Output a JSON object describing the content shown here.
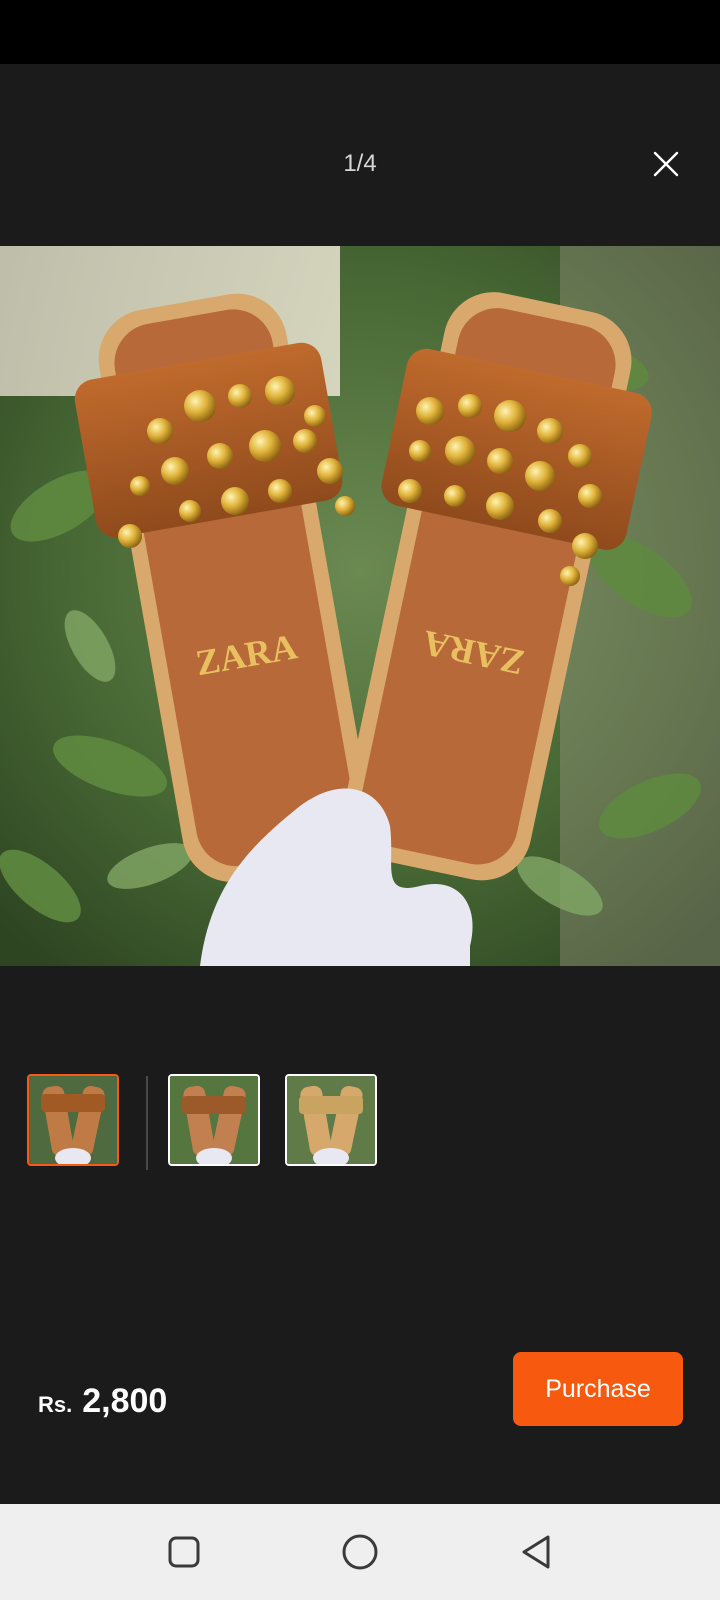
{
  "viewer": {
    "page_counter": "1/4",
    "close_icon": "close-icon"
  },
  "product_image": {
    "brand_mark": "ZARA"
  },
  "thumbnails": [
    {
      "selected": true
    },
    {
      "selected": false
    },
    {
      "selected": false
    }
  ],
  "price": {
    "currency": "Rs.",
    "amount": "2,800"
  },
  "actions": {
    "purchase_label": "Purchase"
  },
  "colors": {
    "accent": "#f75a0e",
    "background": "#1b1b1c"
  },
  "navigation": {
    "recents_icon": "square-icon",
    "home_icon": "circle-icon",
    "back_icon": "triangle-back-icon"
  }
}
